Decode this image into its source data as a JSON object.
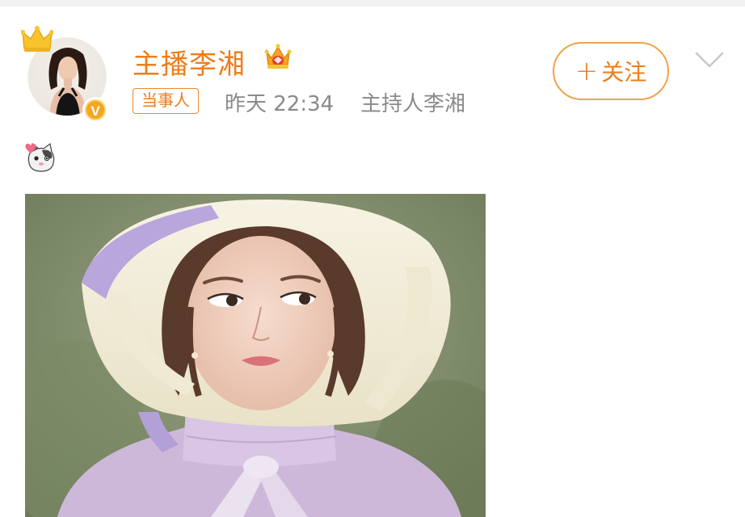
{
  "post": {
    "author": {
      "name": "主播李湘",
      "verified_badge": "V"
    },
    "tag": "当事人",
    "time": "昨天 22:34",
    "source": "主持人李湘",
    "follow_button": {
      "plus": "+",
      "label": "关注"
    },
    "icons": {
      "crown": "crown-icon",
      "vip": "vip-crown-icon",
      "chevron": "chevron-down-icon",
      "emoji": "cat-heart-emoji-icon"
    },
    "colors": {
      "accent": "#ee7d1b",
      "meta_text": "#8a8a8a",
      "follow_border": "#f2a24a"
    }
  }
}
